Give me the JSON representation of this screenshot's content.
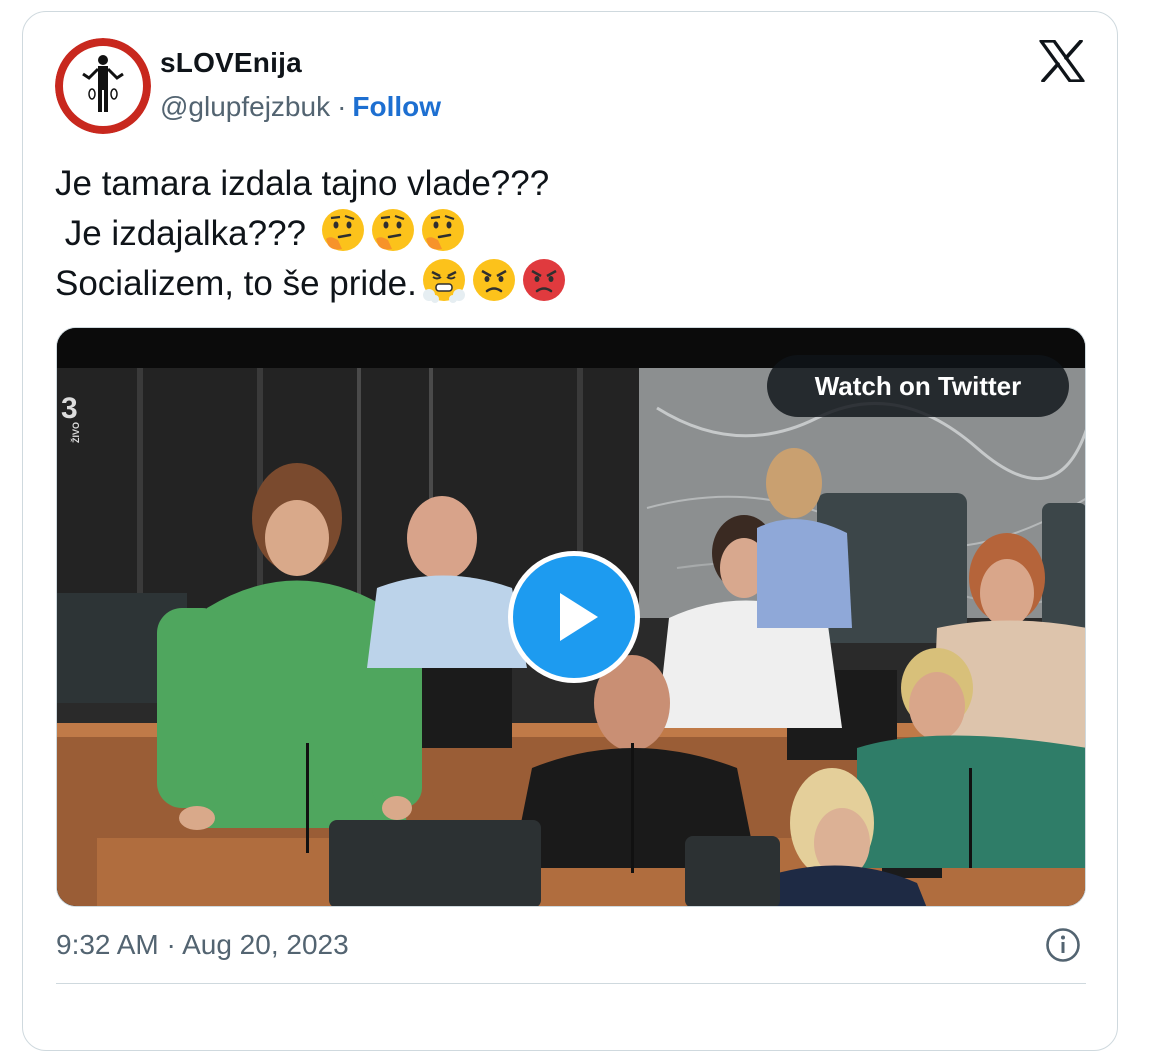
{
  "author": {
    "display_name": "sLOVEnija",
    "handle": "@glupfejzbuk",
    "separator": "·",
    "follow_label": "Follow"
  },
  "tweet": {
    "line1": "Je tamara izdala tajno vlade???",
    "line2": " Je izdajalka??? ",
    "line3": "Socializem, to še pride.",
    "emojis_line2": [
      "thinking-face-emoji",
      "thinking-face-emoji",
      "thinking-face-emoji"
    ],
    "emojis_line3": [
      "face-with-steam-emoji",
      "angry-face-emoji",
      "pouting-face-emoji"
    ]
  },
  "media": {
    "watch_label": "Watch on Twitter",
    "channel_badge": "ŽIVO"
  },
  "footer": {
    "time": "9:32 AM",
    "separator": "·",
    "date": "Aug 20, 2023"
  },
  "icons": {
    "brand": "x-logo-icon",
    "info": "info-icon",
    "play": "play-icon"
  },
  "colors": {
    "follow": "#1d6fd1",
    "play_button": "#1d9bf0",
    "secondary_text": "#536471",
    "border": "#cfd9de"
  }
}
